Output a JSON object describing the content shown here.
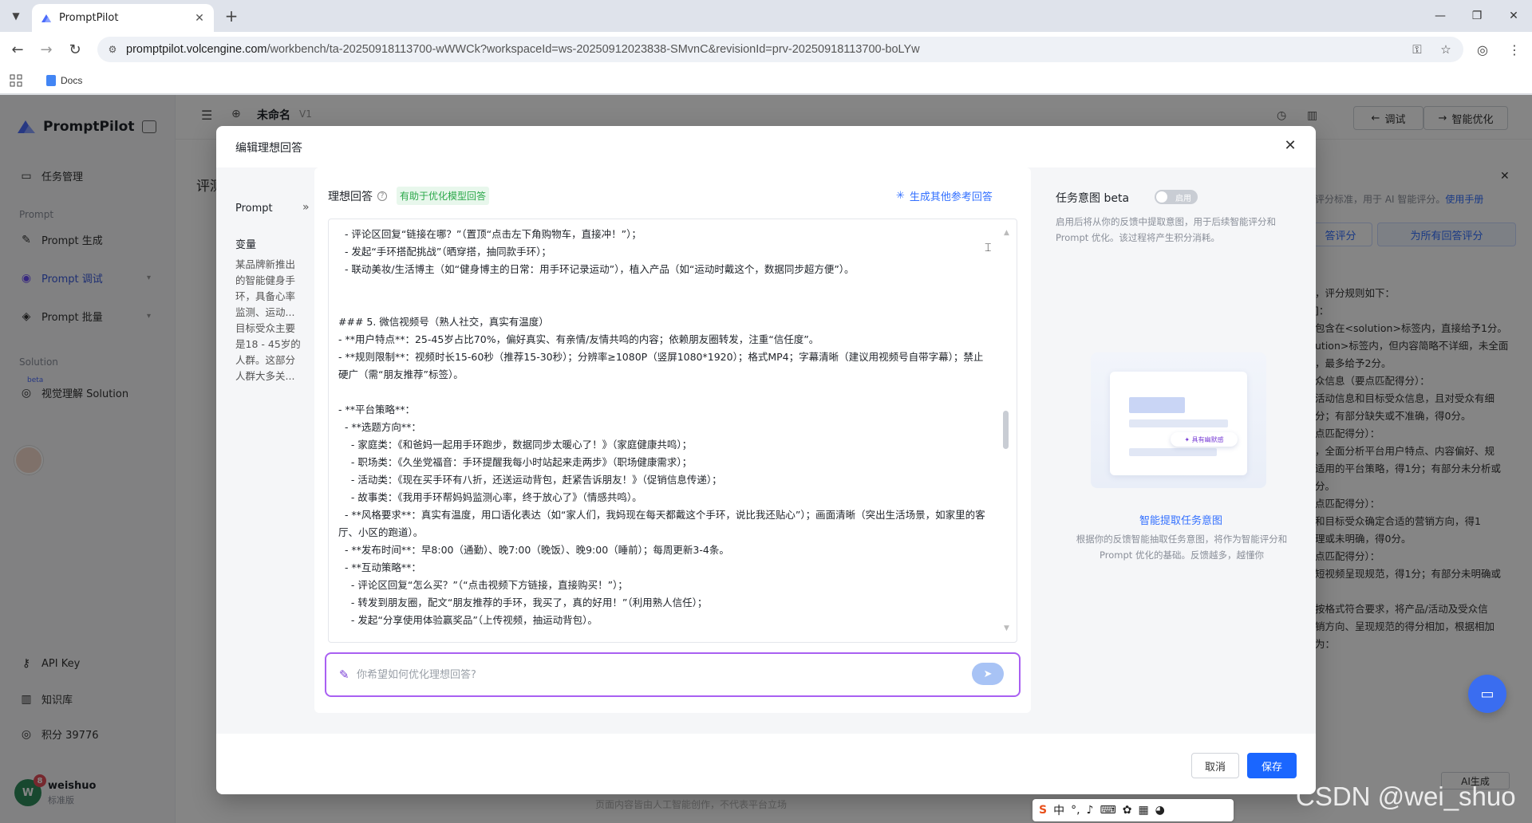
{
  "browser": {
    "tab_title": "PromptPilot",
    "url_host": "promptpilot.volcengine.com",
    "url_path": "/workbench/ta-20250918113700-wWWCk?workspaceId=ws-20250912023838-SMvnC&revisionId=prv-20250918113700-boLYw",
    "bookmark": "Docs"
  },
  "app": {
    "brand": "PromptPilot",
    "doc_name": "未命名",
    "version": "V1",
    "sidebar": {
      "task_mgmt": "任务管理",
      "section_prompt": "Prompt",
      "prompt_gen": "Prompt 生成",
      "prompt_debug": "Prompt 调试",
      "prompt_batch": "Prompt 批量",
      "section_solution": "Solution",
      "visual_solution": "视觉理解 Solution",
      "visual_badge": "beta",
      "api_key": "API Key",
      "knowledge": "知识库",
      "points": "积分 39776",
      "user_name": "weishuo",
      "user_plan": "标准版",
      "user_initial": "W",
      "user_badge": "8"
    },
    "top_buttons": {
      "debug": "调试",
      "optimize": "智能优化"
    },
    "bg_title": "评测",
    "bg_right": {
      "hint": "评分标准，用于 AI 智能评分。",
      "hint_link": "使用手册",
      "tab1": "答评分",
      "tab2": "为所有回答评分",
      "lines": [
        "，评分规则如下：",
        "]：",
        "包含在<solution>标签内，直接给予1分。",
        "ution>标签内，但内容简略不详细，未全面",
        "，最多给予2分。",
        "众信息（要点匹配得分）：",
        "活动信息和目标受众信息，且对受众有细",
        "分；有部分缺失或不准确，得0分。",
        "点匹配得分）：",
        "，全面分析平台用户特点、内容偏好、规",
        "适用的平台策略，得1分；有部分未分析或",
        "分。",
        "点匹配得分）：",
        "和目标受众确定合适的营销方向，得1",
        "理或未明确，得0分。",
        "点匹配得分）：",
        "短视频呈现规范，得1分；有部分未明确或",
        "",
        "按格式符合要求，将产品/活动及受众信",
        "销方向、呈现规范的得分相加，根据相加",
        "为："
      ],
      "ai_gen": "AI生成"
    },
    "footer_note": "页面内容皆由人工智能创作，不代表平台立场"
  },
  "modal": {
    "title": "编辑理想回答",
    "prompt_label": "Prompt",
    "var_label": "变量",
    "var_text_1": "某品牌新推出的智能健身手环，具备心率监测、运动...",
    "var_text_2": "目标受众主要是18 - 45岁的人群。这部分人群大多关...",
    "answer_title": "理想回答",
    "answer_tag": "有助于优化模型回答",
    "gen_link": "生成其他参考回答",
    "answer_lines": [
      "  - 评论区回复“链接在哪？”（置顶“点击左下角购物车，直接冲！”）；",
      "  - 发起“手环搭配挑战”（晒穿搭，抽同款手环）；",
      "  - 联动美妆/生活博主（如“健身博主的日常：用手环记录运动”），植入产品（如“运动时戴这个，数据同步超方便”）。",
      "",
      "",
      "### 5. 微信视频号（熟人社交，真实有温度）",
      "- **用户特点**：25-45岁占比70%，偏好真实、有亲情/友情共鸣的内容；依赖朋友圈转发，注重“信任度”。",
      "- **规则限制**：视频时长15-60秒（推荐15-30秒）；分辨率≥1080P（竖屏1080*1920）；格式MP4；字幕清晰（建议用视频号自带字幕）；禁止硬广（需“朋友推荐”标签）。",
      "",
      "- **平台策略**：",
      "  - **选题方向**：",
      "    - 家庭类：《和爸妈一起用手环跑步，数据同步太暖心了！》（家庭健康共鸣）；",
      "    - 职场类：《久坐党福音：手环提醒我每小时站起来走两步》（职场健康需求）；",
      "    - 活动类：《现在买手环有八折，还送运动背包，赶紧告诉朋友！》（促销信息传递）；",
      "    - 故事类：《我用手环帮妈妈监测心率，终于放心了》（情感共鸣）。",
      "  - **风格要求**：真实有温度，用口语化表达（如“家人们，我妈现在每天都戴这个手环，说比我还贴心”）；画面清晰（突出生活场景，如家里的客厅、小区的跑道）。",
      "  - **发布时间**：早8:00（通勤）、晚7:00（晚饭）、晚9:00（睡前）；每周更新3-4条。",
      "  - **互动策略**：",
      "    - 评论区回复“怎么买？”（“点击视频下方链接，直接购买！”）；",
      "    - 转发到朋友圈，配文“朋友推荐的手环，我买了，真的好用！”（利用熟人信任）；",
      "    - 发起“分享使用体验赢奖品”（上传视频，抽运动背包）。"
    ],
    "input_placeholder": "你希望如何优化理想回答?",
    "input_value": "",
    "intent_title": "任务意图 beta",
    "intent_toggle": "启用",
    "intent_desc": "启用后将从你的反馈中提取意图，用于后续智能评分和 Prompt 优化。该过程将产生积分消耗。",
    "illus_pill": "✦ 具有幽默感",
    "extract_link": "智能提取任务意图",
    "extract_desc": "根据你的反馈智能抽取任务意图，将作为智能评分和 Prompt 优化的基础。反馈越多，越懂你",
    "cancel": "取消",
    "save": "保存"
  },
  "ime": {
    "s": "S",
    "lang": "中"
  },
  "watermark": "CSDN @wei_shuo"
}
